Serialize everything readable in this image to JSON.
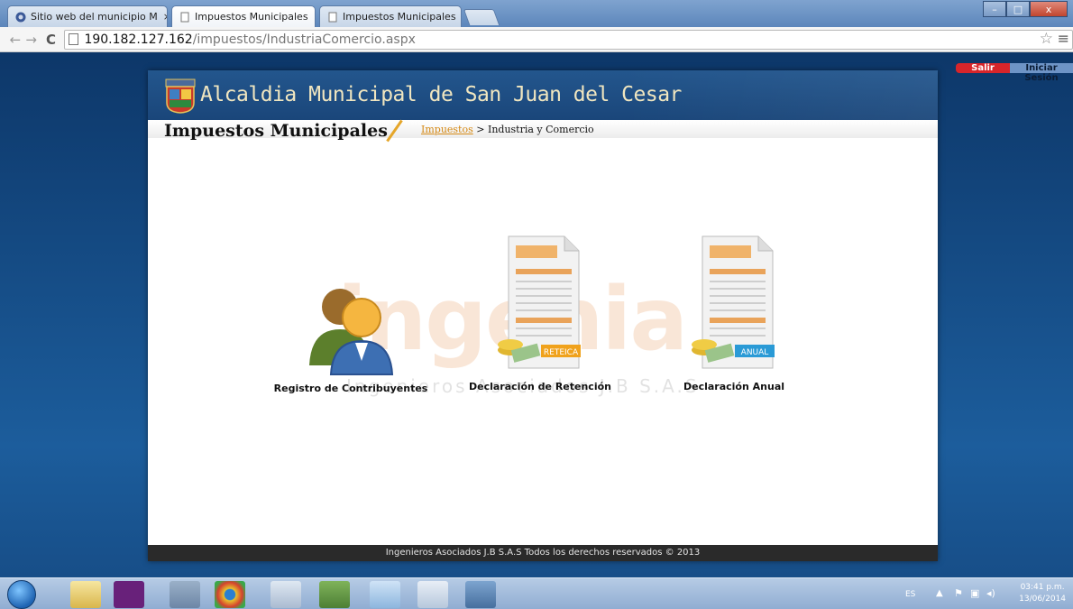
{
  "browser": {
    "tabs": [
      {
        "title": "Sitio web del municipio M",
        "active": false
      },
      {
        "title": "Impuestos Municipales",
        "active": true
      },
      {
        "title": "Impuestos Municipales",
        "active": false
      }
    ],
    "url_host": "190.182.127.162",
    "url_path": "/impuestos/IndustriaComercio.aspx",
    "close_glyph": "×",
    "window_buttons": {
      "minimize": "–",
      "maximize": "□",
      "close": "x"
    }
  },
  "header": {
    "site_title": "Alcaldia Municipal de San Juan del Cesar",
    "logout_label": "Salir",
    "login_label": "Iniciar Sesión"
  },
  "subheader": {
    "title": "Impuestos Municipales",
    "breadcrumb_link": "Impuestos",
    "breadcrumb_separator": " > ",
    "breadcrumb_current": "Industria y Comercio"
  },
  "menu": {
    "registro": {
      "label": "Registro de Contribuyentes"
    },
    "retencion": {
      "label": "Declaración de Retención",
      "badge": "RETEICA"
    },
    "anual": {
      "label": "Declaración Anual",
      "badge": "ANUAL"
    }
  },
  "watermark": {
    "big": "ingenia",
    "sub": "Ingenieros Asociados J.B S.A.S"
  },
  "footer": {
    "text": "Ingenieros Asociados J.B S.A.S Todos los derechos reservados © 2013"
  },
  "taskbar": {
    "language": "ES",
    "time": "03:41 p.m.",
    "date": "13/06/2014"
  },
  "colors": {
    "banner": "#1f4f85",
    "page_bg": "#174e88",
    "accent": "#e5a62a",
    "logout_red": "#d7252a",
    "reteica_badge": "#f0a21c",
    "anual_badge": "#2a9ad6"
  }
}
